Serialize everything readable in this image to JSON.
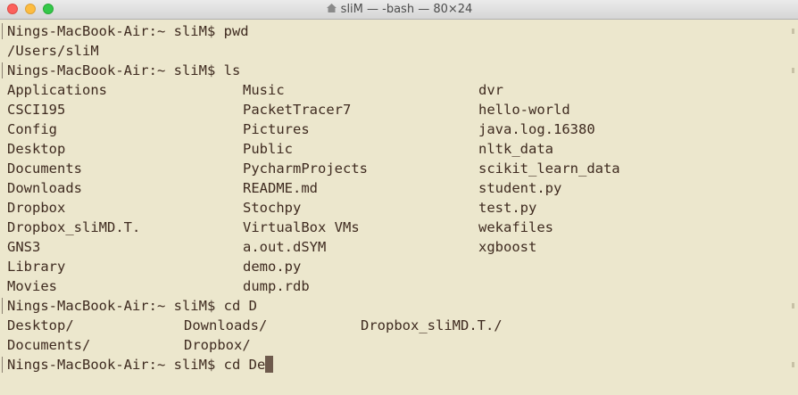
{
  "window": {
    "title": "sliM — -bash — 80×24"
  },
  "terminal": {
    "prompt": "Nings-MacBook-Air:~ sliM$ ",
    "commands": {
      "pwd": "pwd",
      "ls": "ls",
      "cd_d": "cd D",
      "cd_de": "cd De"
    },
    "pwd_output": "/Users/sliM",
    "ls_columns": [
      [
        "Applications",
        "CSCI195",
        "Config",
        "Desktop",
        "Documents",
        "Downloads",
        "Dropbox",
        "Dropbox_sliMD.T.",
        "GNS3",
        "Library",
        "Movies"
      ],
      [
        "Music",
        "PacketTracer7",
        "Pictures",
        "Public",
        "PycharmProjects",
        "README.md",
        "Stochpy",
        "VirtualBox VMs",
        "a.out.dSYM",
        "demo.py",
        "dump.rdb"
      ],
      [
        "dvr",
        "hello-world",
        "java.log.16380",
        "nltk_data",
        "scikit_learn_data",
        "student.py",
        "test.py",
        "wekafiles",
        "xgboost"
      ]
    ],
    "completion_rows": [
      [
        "Desktop/",
        "Downloads/",
        "Dropbox_sliMD.T./"
      ],
      [
        "Documents/",
        "Dropbox/"
      ]
    ]
  },
  "colors": {
    "background": "#ece7cd",
    "text": "#3f2b20",
    "cursor": "#6e5a4c"
  }
}
